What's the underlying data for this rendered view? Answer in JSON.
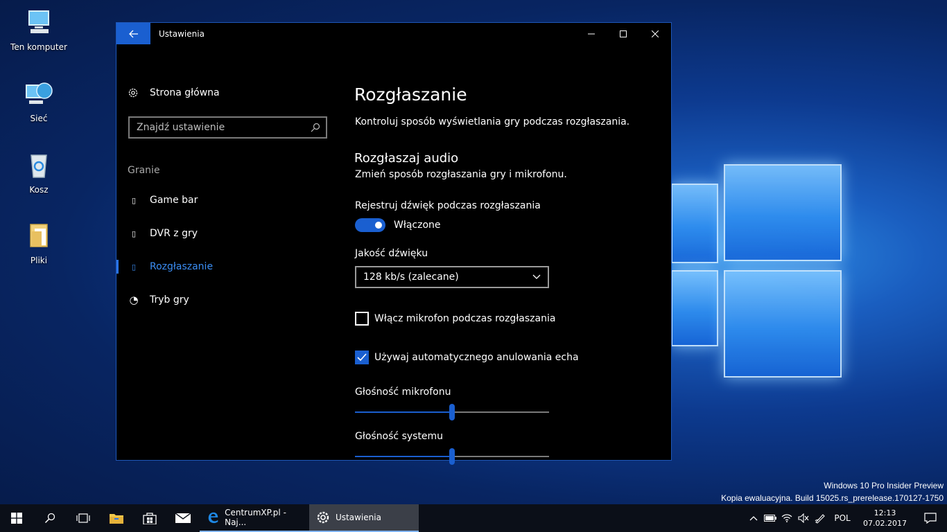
{
  "desktop": {
    "icons": [
      {
        "label": "Ten komputer"
      },
      {
        "label": "Sieć"
      },
      {
        "label": "Kosz"
      },
      {
        "label": "Pliki"
      }
    ],
    "watermark": {
      "line1": "Windows 10 Pro Insider Preview",
      "line2": "Kopia ewaluacyjna. Build 15025.rs_prerelease.170127-1750"
    }
  },
  "window": {
    "title": "Ustawienia",
    "back_icon": "back-arrow-icon",
    "minimize_glyph": "—",
    "maximize_glyph": "☐",
    "close_glyph": "✕"
  },
  "nav": {
    "home_label": "Strona główna",
    "search_placeholder": "Znajdź ustawienie",
    "section_label": "Granie",
    "items": [
      {
        "label": "Game bar",
        "icon": "game-bar-icon",
        "glyph": "▯"
      },
      {
        "label": "DVR z gry",
        "icon": "dvr-icon",
        "glyph": "▯"
      },
      {
        "label": "Rozgłaszanie",
        "icon": "broadcast-icon",
        "glyph": "▯"
      },
      {
        "label": "Tryb gry",
        "icon": "game-mode-icon",
        "glyph": "◔"
      }
    ],
    "active_index": 2
  },
  "content": {
    "title": "Rozgłaszanie",
    "description": "Kontroluj sposób wyświetlania gry podczas rozgłaszania.",
    "audio_heading": "Rozgłaszaj audio",
    "audio_sub": "Zmień sposób rozgłaszania gry i mikrofonu.",
    "record_label": "Rejestruj dźwięk podczas rozgłaszania",
    "record_toggle": {
      "state": "Włączone",
      "on": true
    },
    "quality_label": "Jakość dźwięku",
    "quality_value": "128 kb/s (zalecane)",
    "mic_checkbox": {
      "label": "Włącz mikrofon podczas rozgłaszania",
      "checked": false
    },
    "echo_checkbox": {
      "label": "Używaj automatycznego anulowania echa",
      "checked": true
    },
    "mic_volume": {
      "label": "Głośność mikrofonu",
      "value": 50
    },
    "system_volume": {
      "label": "Głośność systemu",
      "value": 50
    }
  },
  "taskbar": {
    "apps": [
      {
        "label": "CentrumXP.pl - Naj...",
        "icon": "edge-icon"
      },
      {
        "label": "Ustawienia",
        "icon": "gear-icon"
      }
    ],
    "language": "POL",
    "time": "12:13",
    "date": "07.02.2017"
  },
  "colors": {
    "accent": "#1a5fd0",
    "active_nav": "#3b8ef5",
    "window_bg": "#000000",
    "taskbar_bg": "#0b0f18"
  }
}
